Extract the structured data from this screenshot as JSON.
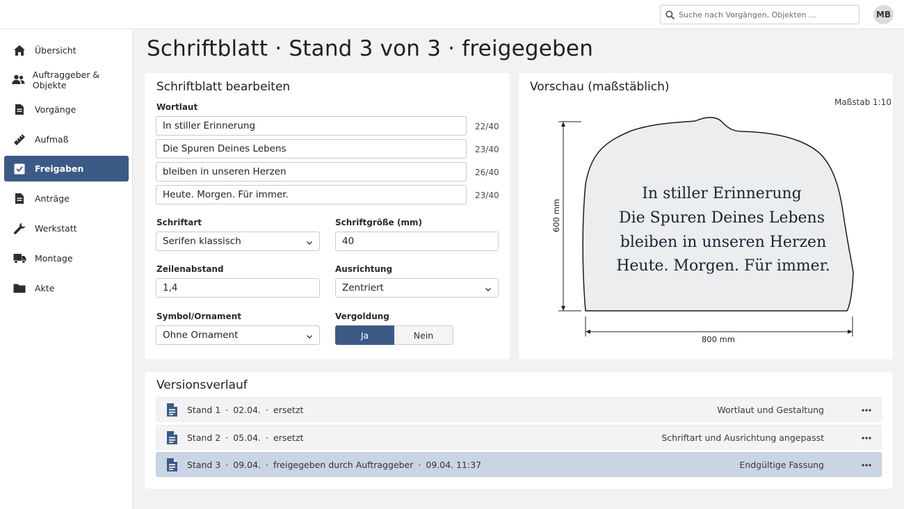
{
  "header": {
    "search_placeholder": "Suche nach Vorgängen, Objekten ...",
    "user_initials": "MB"
  },
  "sidebar": {
    "items": [
      {
        "label": "Übersicht",
        "icon": "home-icon"
      },
      {
        "label": "Auftraggeber & Objekte",
        "icon": "people-icon"
      },
      {
        "label": "Vorgänge",
        "icon": "document-icon"
      },
      {
        "label": "Aufmaß",
        "icon": "ruler-icon"
      },
      {
        "label": "Freigaben",
        "icon": "checkbox-icon",
        "active": true
      },
      {
        "label": "Anträge",
        "icon": "document-icon"
      },
      {
        "label": "Werkstatt",
        "icon": "wrench-icon"
      },
      {
        "label": "Montage",
        "icon": "truck-icon"
      },
      {
        "label": "Akte",
        "icon": "folder-icon"
      }
    ]
  },
  "page": {
    "title": "Schriftblatt · Stand 3 von 3 · freigegeben"
  },
  "editor": {
    "title": "Schriftblatt bearbeiten",
    "wording_label": "Wortlaut",
    "lines": [
      {
        "text": "In stiller Erinnerung",
        "count": "22/40"
      },
      {
        "text": "Die Spuren Deines Lebens",
        "count": "23/40"
      },
      {
        "text": "bleiben in unseren Herzen",
        "count": "26/40"
      },
      {
        "text": "Heute. Morgen. Für immer.",
        "count": "23/40"
      }
    ],
    "font_label": "Schriftart",
    "font_value": "Serifen klassisch",
    "size_label": "Schriftgröße (mm)",
    "size_value": "40",
    "spacing_label": "Zeilenabstand",
    "spacing_value": "1,4",
    "align_label": "Ausrichtung",
    "align_value": "Zentriert",
    "ornament_label": "Symbol/Ornament",
    "ornament_value": "Ohne Ornament",
    "gilding_label": "Vergoldung",
    "gilding_yes": "Ja",
    "gilding_no": "Nein",
    "gilding_selected": "Ja"
  },
  "preview": {
    "title": "Vorschau (maßstäblich)",
    "scale": "Maßstab 1:10",
    "height_label": "600 mm",
    "width_label": "800 mm",
    "stone_color": "#ebedee"
  },
  "versions": {
    "title": "Versionsverlauf",
    "rows": [
      {
        "stand": "Stand 1",
        "date": "02.04.",
        "status": "ersetzt",
        "time": "",
        "note": "Wortlaut und Gestaltung",
        "current": false
      },
      {
        "stand": "Stand 2",
        "date": "05.04.",
        "status": "ersetzt",
        "time": "",
        "note": "Schriftart und Ausrichtung angepasst",
        "current": false
      },
      {
        "stand": "Stand 3",
        "date": "09.04.",
        "status": "freigegeben durch Auftraggeber",
        "time": "09.04. 11:37",
        "note": "Endgültige Fassung",
        "current": true
      }
    ]
  },
  "colors": {
    "accent": "#3c5a86",
    "current_row": "#c9d4e4"
  }
}
